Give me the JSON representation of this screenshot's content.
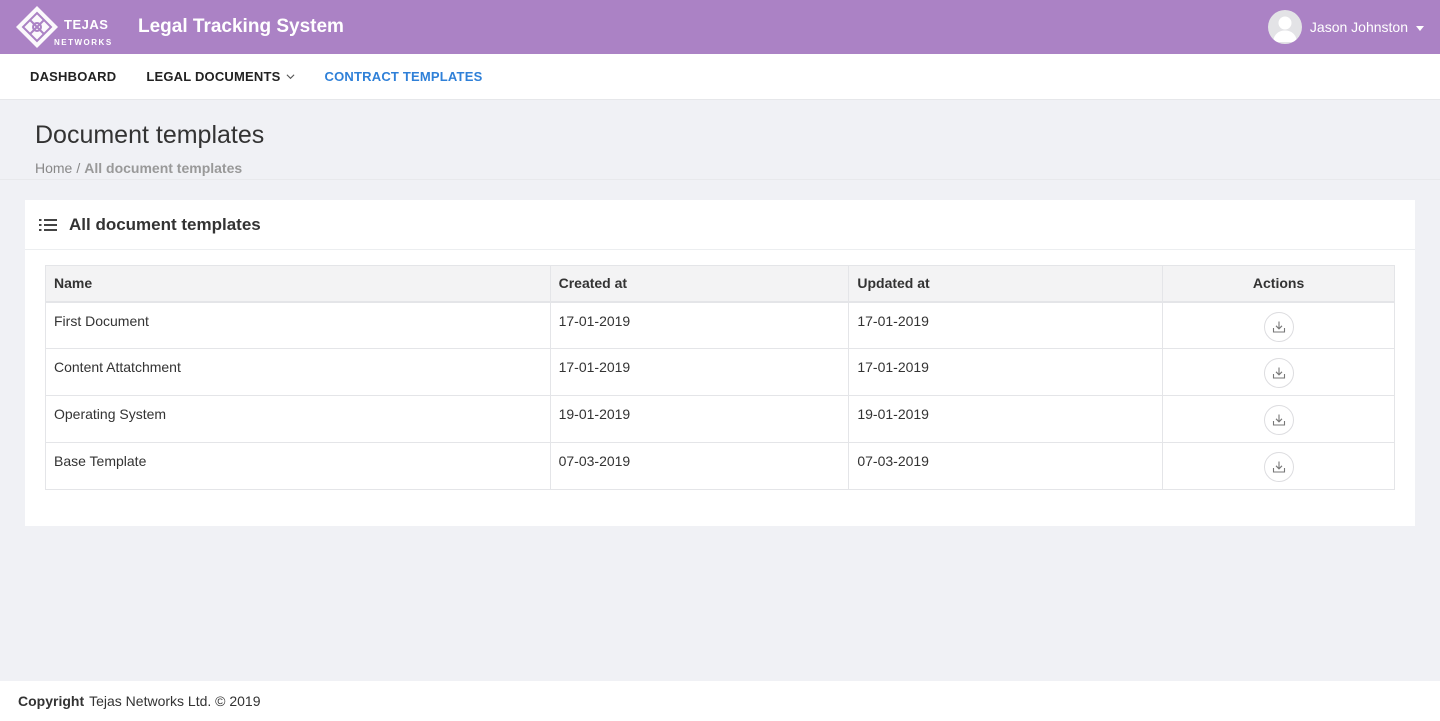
{
  "header": {
    "logo_text": "TEJAS",
    "logo_sub": "NETWORKS",
    "app_title": "Legal Tracking System",
    "user_name": "Jason Johnston",
    "accent_color": "#ab82c5"
  },
  "nav": {
    "items": [
      {
        "label": "DASHBOARD"
      },
      {
        "label": "LEGAL DOCUMENTS"
      },
      {
        "label": "CONTRACT TEMPLATES"
      }
    ],
    "active_color": "#2f80d8"
  },
  "page": {
    "title": "Document templates",
    "breadcrumb_home": "Home",
    "breadcrumb_sep": "/",
    "breadcrumb_current": "All document templates"
  },
  "card": {
    "title": "All document templates",
    "columns": {
      "name": "Name",
      "created": "Created at",
      "updated": "Updated at",
      "actions": "Actions"
    },
    "rows": [
      {
        "name": "First Document",
        "created": "17-01-2019",
        "updated": "17-01-2019"
      },
      {
        "name": "Content Attatchment",
        "created": "17-01-2019",
        "updated": "17-01-2019"
      },
      {
        "name": "Operating System",
        "created": "19-01-2019",
        "updated": "19-01-2019"
      },
      {
        "name": "Base Template",
        "created": "07-03-2019",
        "updated": "07-03-2019"
      }
    ],
    "action_icon": "download-icon"
  },
  "footer": {
    "label": "Copyright",
    "text": "Tejas Networks Ltd. © 2019"
  }
}
